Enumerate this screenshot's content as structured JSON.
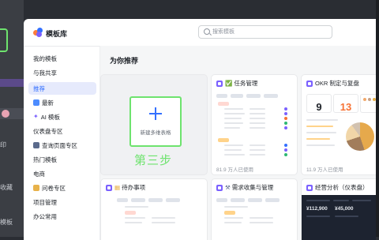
{
  "modal": {
    "title": "模板库",
    "search_placeholder": "搜索模板"
  },
  "sidebar": {
    "items": [
      {
        "label": "我的模板"
      },
      {
        "label": "与我共享"
      },
      {
        "label": "推荐"
      },
      {
        "label": "最新"
      },
      {
        "label": "AI 模板"
      },
      {
        "label": "仪表盘专区"
      },
      {
        "label": "查询页面专区"
      },
      {
        "label": "热门模板"
      },
      {
        "label": "电商"
      },
      {
        "label": "问卷专区"
      },
      {
        "label": "项目管理"
      },
      {
        "label": "办公常用"
      }
    ]
  },
  "main": {
    "section_title": "为你推荐",
    "new_card": {
      "label": "新建多维表格",
      "annotation": "第三步"
    },
    "cards": [
      {
        "name": "任务管理",
        "usage": "81.9 万人已使用"
      },
      {
        "name": "OKR 制定与复盘",
        "usage": "11.9 万人已使用"
      },
      {
        "name": "待办事项"
      },
      {
        "name": "需求收集与管理"
      },
      {
        "name": "经营分析（仪表盘）"
      }
    ],
    "okr_numbers": [
      "9",
      "13"
    ],
    "finance_numbers": [
      "¥112,900",
      "¥45,000"
    ]
  },
  "background": {
    "items": [
      "收藏",
      "模板",
      "印"
    ]
  },
  "colors": {
    "accent": "#3370ff",
    "highlight": "#6ee36e",
    "template_tag": "#7b61ff",
    "active_bg": "#e6eafc"
  }
}
